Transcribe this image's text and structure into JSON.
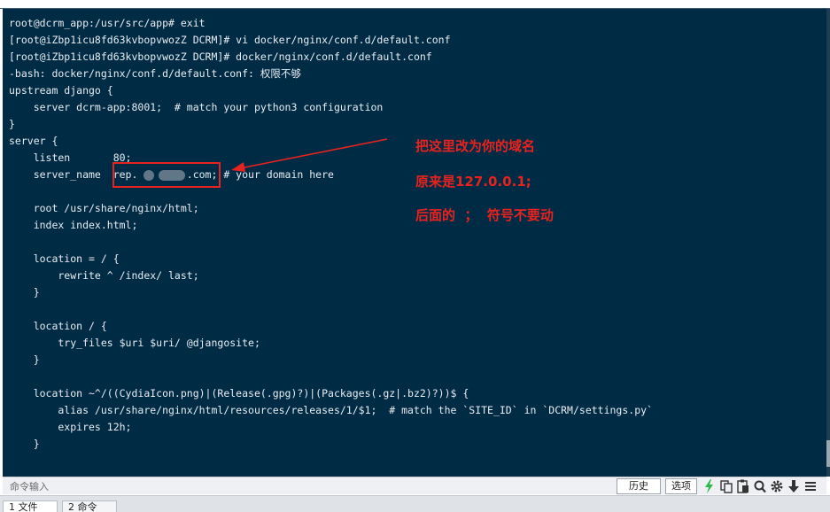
{
  "terminal": {
    "lines": [
      "root@dcrm_app:/usr/src/app# exit",
      "[root@iZbp1icu8fd63kvbopvwozZ DCRM]# vi docker/nginx/conf.d/default.conf",
      "[root@iZbp1icu8fd63kvbopvwozZ DCRM]# docker/nginx/conf.d/default.conf",
      "-bash: docker/nginx/conf.d/default.conf: 权限不够",
      "upstream django {",
      "    server dcrm-app:8001;  # match your python3 configuration",
      "}",
      "server {",
      "    listen       80;",
      "    server_name  rep.        .com; # your domain here",
      "",
      "    root /usr/share/nginx/html;",
      "    index index.html;",
      "",
      "    location = / {",
      "        rewrite ^ /index/ last;",
      "    }",
      "",
      "    location / {",
      "        try_files $uri $uri/ @djangosite;",
      "    }",
      "",
      "    location ~^/((CydiaIcon.png)|(Release(.gpg)?)|(Packages(.gz|.bz2)?))$ {",
      "        alias /usr/share/nginx/html/resources/releases/1/$1;  # match the `SITE_ID` in `DCRM/settings.py`",
      "        expires 12h;",
      "    }"
    ]
  },
  "annotations": {
    "line1": "把这里改为你的域名",
    "line2": "原来是127.0.0.1;",
    "line3": "后面的  ；  符号不要动",
    "color": "#e8231f"
  },
  "command_bar": {
    "placeholder": "命令输入",
    "history_label": "历史",
    "options_label": "选项",
    "tool_icons": [
      "lightning-icon",
      "copy-icon",
      "paste-icon",
      "search-icon",
      "gear-icon",
      "download-icon",
      "menu-icon"
    ]
  },
  "tabs": [
    {
      "label": "1 文件",
      "active": true
    },
    {
      "label": "2 命令",
      "active": false
    }
  ],
  "colors": {
    "terminal_bg": "#002b44",
    "terminal_text": "#e8edf2",
    "accent_green": "#2db84d"
  }
}
